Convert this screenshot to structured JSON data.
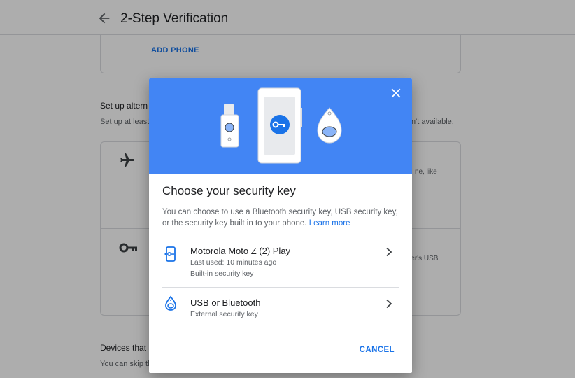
{
  "appbar": {
    "title": "2-Step Verification",
    "back_icon": "arrow-back-icon"
  },
  "background": {
    "add_phone_label": "ADD PHONE",
    "alt_heading": "Set up altern",
    "alt_sub_left": "Set up at least",
    "alt_sub_right": "n't available.",
    "airplane_icon": "airplane-icon",
    "key_icon": "key-icon",
    "alt_text_1": "ne, like",
    "alt_text_2": "uter's USB",
    "devices_heading": "Devices that",
    "devices_sub": "You can skip th"
  },
  "dialog": {
    "close_icon": "close-icon",
    "title": "Choose your security key",
    "description": "You can choose to use a Bluetooth security key, USB security key, or the security key built in to your phone.",
    "learn_more": "Learn more",
    "options": [
      {
        "icon": "phone-key-icon",
        "title": "Motorola Moto Z (2) Play",
        "line1": "Last used: 10 minutes ago",
        "line2": "Built-in security key"
      },
      {
        "icon": "bluetooth-key-icon",
        "title": "USB or Bluetooth",
        "line1": "External security key"
      }
    ],
    "cancel_label": "CANCEL"
  },
  "colors": {
    "accent": "#1a73e8",
    "hero_blue": "#4285f4"
  }
}
